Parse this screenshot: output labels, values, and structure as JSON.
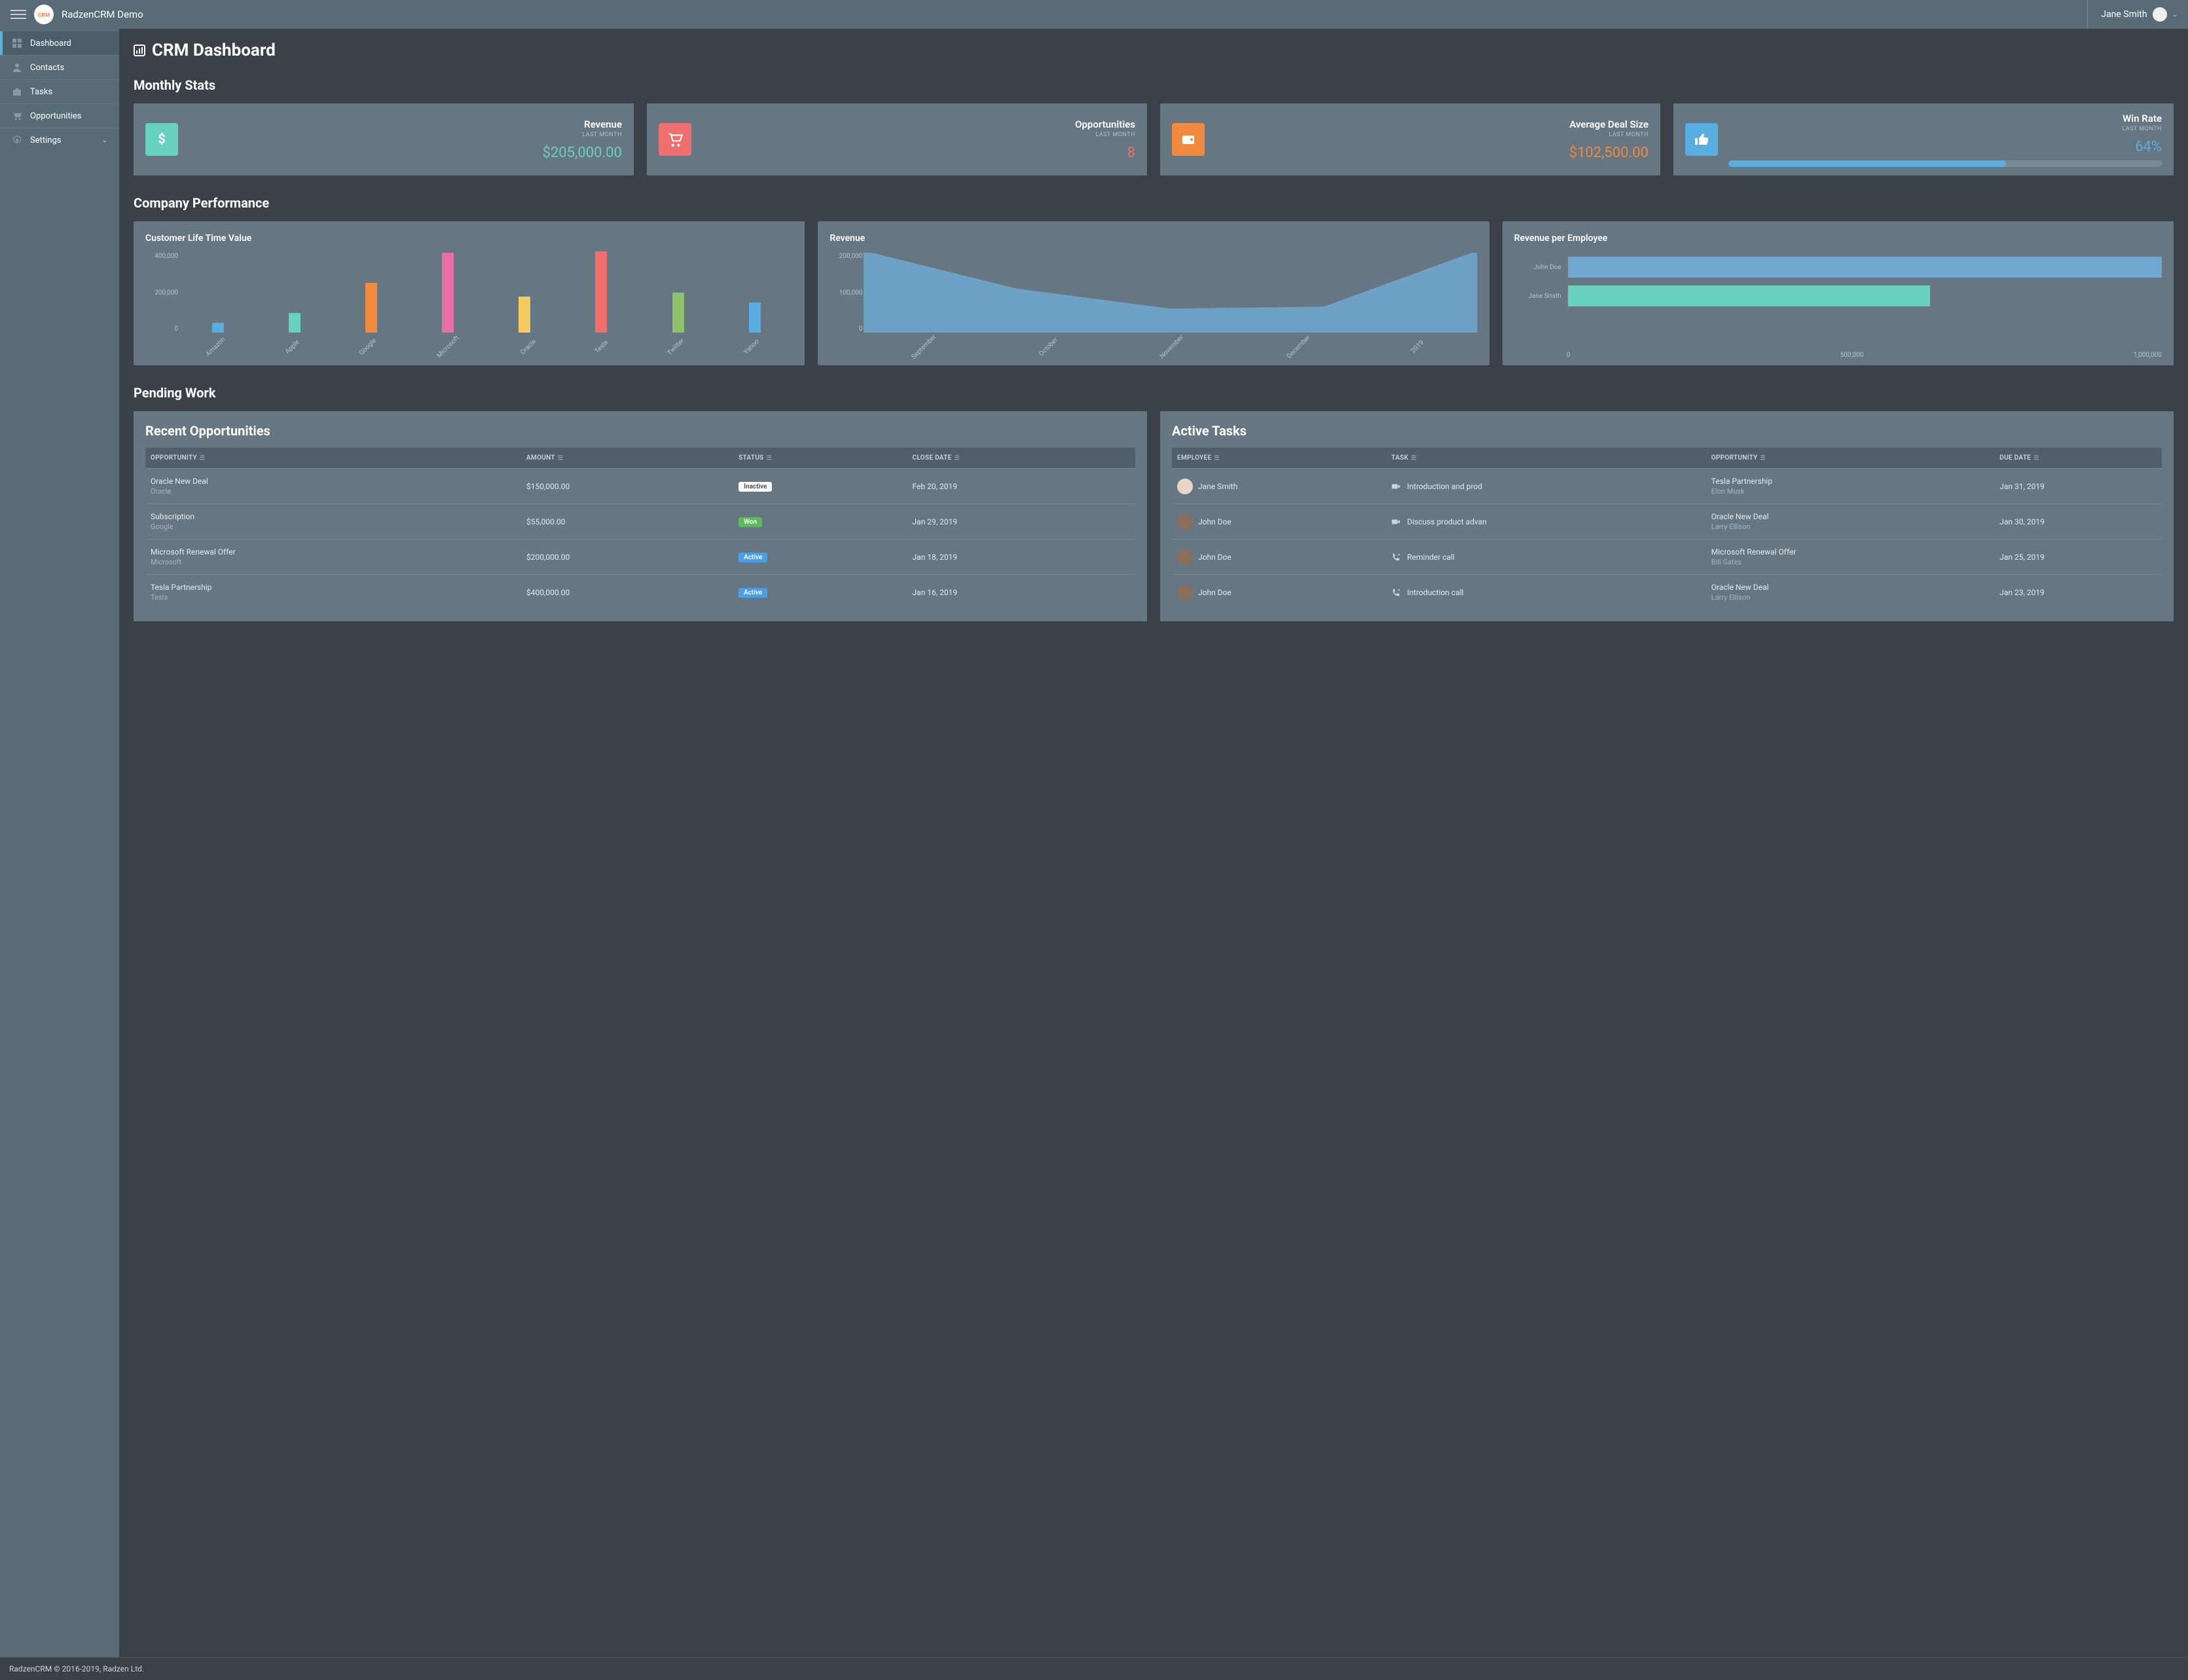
{
  "app": {
    "title": "RadzenCRM Demo"
  },
  "user": {
    "name": "Jane Smith"
  },
  "nav": [
    {
      "label": "Dashboard",
      "icon": "dashboard",
      "active": true
    },
    {
      "label": "Contacts",
      "icon": "contacts"
    },
    {
      "label": "Tasks",
      "icon": "tasks"
    },
    {
      "label": "Opportunities",
      "icon": "cart"
    },
    {
      "label": "Settings",
      "icon": "gear",
      "expandable": true
    }
  ],
  "page": {
    "title": "CRM Dashboard"
  },
  "monthly": {
    "title": "Monthly Stats",
    "subtitle": "LAST MONTH",
    "cards": [
      {
        "label": "Revenue",
        "value": "$205,000.00",
        "color": "#68d0c0",
        "icon": "dollar"
      },
      {
        "label": "Opportunities",
        "value": "8",
        "color": "#ef6e6e",
        "icon": "cart"
      },
      {
        "label": "Average Deal Size",
        "value": "$102,500.00",
        "color": "#f18a3f",
        "icon": "wallet"
      },
      {
        "label": "Win Rate",
        "value": "64%",
        "color": "#58aee0",
        "icon": "thumb",
        "progress": 64
      }
    ]
  },
  "performance": {
    "title": "Company Performance"
  },
  "pending": {
    "title": "Pending Work"
  },
  "opportunities": {
    "title": "Recent Opportunities",
    "headers": [
      "OPPORTUNITY",
      "AMOUNT",
      "STATUS",
      "CLOSE DATE"
    ],
    "rows": [
      {
        "name": "Oracle New Deal",
        "company": "Oracle",
        "amount": "$150,000.00",
        "status": "Inactive",
        "badge": "inactive",
        "close": "Feb 20, 2019"
      },
      {
        "name": "Subscription",
        "company": "Google",
        "amount": "$55,000.00",
        "status": "Won",
        "badge": "won",
        "close": "Jan 29, 2019"
      },
      {
        "name": "Microsoft Renewal Offer",
        "company": "Microsoft",
        "amount": "$200,000.00",
        "status": "Active",
        "badge": "active",
        "close": "Jan 18, 2019"
      },
      {
        "name": "Tesla Partnership",
        "company": "Tesla",
        "amount": "$400,000.00",
        "status": "Active",
        "badge": "active",
        "close": "Jan 16, 2019"
      }
    ]
  },
  "tasks": {
    "title": "Active Tasks",
    "headers": [
      "EMPLOYEE",
      "TASK",
      "OPPORTUNITY",
      "DUE DATE"
    ],
    "rows": [
      {
        "employee": "Jane Smith",
        "task": "Introduction and prod",
        "icon": "video",
        "opp": "Tesla Partnership",
        "contact": "Elon Musk",
        "due": "Jan 31, 2019"
      },
      {
        "employee": "John Doe",
        "task": "Discuss product advan",
        "icon": "video",
        "opp": "Oracle New Deal",
        "contact": "Larry Ellison",
        "due": "Jan 30, 2019"
      },
      {
        "employee": "John Doe",
        "task": "Reminder call",
        "icon": "phone",
        "opp": "Microsoft Renewal Offer",
        "contact": "Bill Gates",
        "due": "Jan 25, 2019"
      },
      {
        "employee": "John Doe",
        "task": "Introduction call",
        "icon": "phone",
        "opp": "Oracle New Deal",
        "contact": "Larry Ellison",
        "due": "Jan 23, 2019"
      }
    ]
  },
  "footer": "RadzenCRM © 2016-2019, Radzen Ltd.",
  "chart_data": [
    {
      "type": "bar",
      "title": "Customer Life Time Value",
      "categories": [
        "Amazon",
        "Apple",
        "Google",
        "Microsoft",
        "Oracle",
        "Tesla",
        "Twitter",
        "Yahoo"
      ],
      "values": [
        50000,
        100000,
        250000,
        400000,
        180000,
        405000,
        200000,
        150000
      ],
      "colors": [
        "#58aee0",
        "#68d0c0",
        "#f18a3f",
        "#e76fa3",
        "#f2cc5e",
        "#ef6e6e",
        "#8fc06b",
        "#58aee0"
      ],
      "ylim": [
        0,
        400000
      ],
      "yticks": [
        "0",
        "200,000",
        "400,000"
      ]
    },
    {
      "type": "area",
      "title": "Revenue",
      "categories": [
        "September",
        "October",
        "November",
        "December",
        "2019"
      ],
      "values": [
        205000,
        110000,
        60000,
        65000,
        205000
      ],
      "ylim": [
        0,
        200000
      ],
      "yticks": [
        "0",
        "100,000",
        "200,000"
      ],
      "color": "#6fa9d2"
    },
    {
      "type": "bar",
      "orientation": "horizontal",
      "title": "Revenue per Employee",
      "categories": [
        "John Doe",
        "Jane Smith"
      ],
      "values": [
        1000000,
        610000
      ],
      "colors": [
        "#6fa9d2",
        "#68d0c0"
      ],
      "xlim": [
        0,
        1000000
      ],
      "xticks": [
        "0",
        "500,000",
        "1,000,000"
      ]
    }
  ]
}
